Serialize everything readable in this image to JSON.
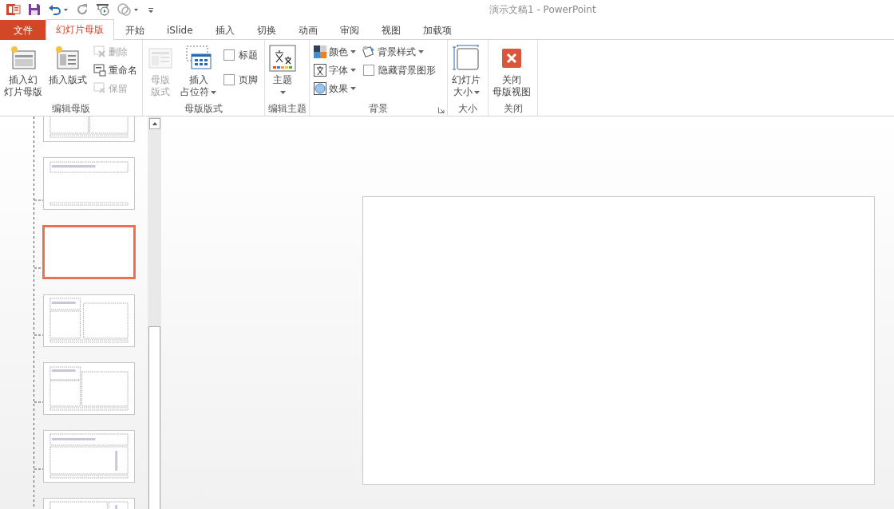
{
  "title": "演示文稿1 - PowerPoint",
  "tabs": [
    {
      "label": "文件",
      "kind": "file",
      "selected": false
    },
    {
      "label": "幻灯片母版",
      "kind": "tab",
      "selected": true
    },
    {
      "label": "开始",
      "kind": "tab",
      "selected": false
    },
    {
      "label": "iSlide",
      "kind": "tab",
      "selected": false
    },
    {
      "label": "插入",
      "kind": "tab",
      "selected": false
    },
    {
      "label": "切换",
      "kind": "tab",
      "selected": false
    },
    {
      "label": "动画",
      "kind": "tab",
      "selected": false
    },
    {
      "label": "审阅",
      "kind": "tab",
      "selected": false
    },
    {
      "label": "视图",
      "kind": "tab",
      "selected": false
    },
    {
      "label": "加载项",
      "kind": "tab",
      "selected": false
    }
  ],
  "groups": [
    {
      "label": "编辑母版",
      "columns": [
        {
          "items": [
            {
              "kind": "large",
              "lines": [
                "插入幻",
                "灯片母版"
              ],
              "disabled": false,
              "dropdown": false
            }
          ]
        },
        {
          "items": [
            {
              "kind": "large",
              "lines": [
                "插入版式"
              ],
              "disabled": false,
              "dropdown": false
            }
          ]
        },
        {
          "items": [
            {
              "kind": "small",
              "label": "删除",
              "disabled": true,
              "dropdown": false
            },
            {
              "kind": "small",
              "label": "重命名",
              "disabled": false,
              "dropdown": false
            },
            {
              "kind": "small",
              "label": "保留",
              "disabled": true,
              "dropdown": false
            }
          ]
        }
      ]
    },
    {
      "label": "母版版式",
      "columns": [
        {
          "items": [
            {
              "kind": "large",
              "lines": [
                "母版",
                "版式"
              ],
              "disabled": true,
              "dropdown": false
            }
          ]
        },
        {
          "items": [
            {
              "kind": "large",
              "lines": [
                "插入",
                "占位符"
              ],
              "disabled": false,
              "dropdown": true
            }
          ]
        },
        {
          "items": [
            {
              "kind": "check",
              "label": "标题",
              "checked": false
            },
            {
              "kind": "check",
              "label": "页脚",
              "checked": false
            }
          ]
        }
      ]
    },
    {
      "label": "编辑主题",
      "columns": [
        {
          "items": [
            {
              "kind": "large",
              "lines": [
                "主题"
              ],
              "disabled": false,
              "dropdown": true
            }
          ]
        }
      ]
    },
    {
      "label": "背景",
      "launcher": true,
      "columns": [
        {
          "items": [
            {
              "kind": "small",
              "label": "颜色",
              "disabled": false,
              "dropdown": true
            },
            {
              "kind": "small",
              "label": "字体",
              "disabled": false,
              "dropdown": true
            },
            {
              "kind": "small",
              "label": "效果",
              "disabled": false,
              "dropdown": true
            }
          ]
        },
        {
          "items": [
            {
              "kind": "small",
              "label": "背景样式",
              "disabled": false,
              "dropdown": true
            },
            {
              "kind": "check",
              "label": "隐藏背景图形",
              "checked": false
            }
          ]
        }
      ]
    },
    {
      "label": "大小",
      "columns": [
        {
          "items": [
            {
              "kind": "large",
              "lines": [
                "幻灯片",
                "大小"
              ],
              "disabled": false,
              "dropdown": true
            }
          ]
        }
      ]
    },
    {
      "label": "关闭",
      "columns": [
        {
          "items": [
            {
              "kind": "large",
              "lines": [
                "关闭",
                "母版视图"
              ],
              "disabled": false,
              "dropdown": false
            }
          ]
        }
      ]
    }
  ],
  "thumbnails": [
    {
      "kind": "two-content",
      "selected": false
    },
    {
      "kind": "title-only",
      "selected": false
    },
    {
      "kind": "blank",
      "selected": true
    },
    {
      "kind": "comparison",
      "selected": false
    },
    {
      "kind": "content-caption",
      "selected": false
    },
    {
      "kind": "vertical-text",
      "selected": false
    },
    {
      "kind": "vertical-title",
      "selected": false
    }
  ]
}
